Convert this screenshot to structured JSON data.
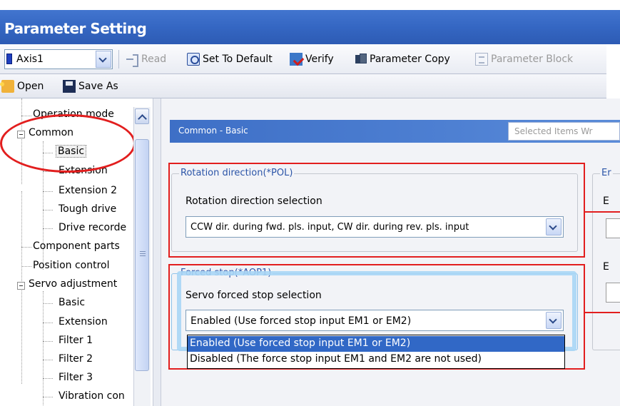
{
  "window": {
    "title": "Parameter Setting"
  },
  "toolbar1": {
    "axis": {
      "value": "Axis1"
    },
    "read": {
      "label": "Read",
      "icon": "read-arrow-icon"
    },
    "set_default": {
      "label": "Set To Default",
      "icon": "default-icon"
    },
    "verify": {
      "label": "Verify",
      "icon": "verify-icon"
    },
    "param_copy": {
      "label": "Parameter Copy",
      "icon": "copy-icon"
    },
    "param_block": {
      "label": "Parameter Block",
      "icon": "block-icon"
    }
  },
  "toolbar2": {
    "open": {
      "label": "Open",
      "icon": "open-folder-icon"
    },
    "save_as": {
      "label": "Save As",
      "icon": "save-disk-icon"
    }
  },
  "tree": {
    "items": [
      {
        "label": "Operation mode"
      },
      {
        "label": "Common"
      },
      {
        "label": "Basic"
      },
      {
        "label": "Extension"
      },
      {
        "label": "Extension 2"
      },
      {
        "label": "Tough drive"
      },
      {
        "label": "Drive recorde"
      },
      {
        "label": "Component parts"
      },
      {
        "label": "Position control"
      },
      {
        "label": "Servo adjustment"
      },
      {
        "label": "Basic"
      },
      {
        "label": "Extension"
      },
      {
        "label": "Filter 1"
      },
      {
        "label": "Filter 2"
      },
      {
        "label": "Filter 3"
      },
      {
        "label": "Vibration con"
      }
    ]
  },
  "content": {
    "header_title": "Common - Basic",
    "search_placeholder": "Selected Items Wr",
    "rotation_group": {
      "title": "Rotation direction(*POL)",
      "field_label": "Rotation direction selection",
      "selected": "CCW dir. during fwd. pls. input, CW dir. during rev. pls. input"
    },
    "forced_stop_group": {
      "title": "Forced stop(*AOP1)",
      "field_label": "Servo forced stop selection",
      "selected": "Enabled (Use forced stop input EM1 or EM2)",
      "options": [
        "Enabled (Use forced stop input EM1 or EM2)",
        "Disabled (The force stop input EM1 and EM2 are not used)"
      ]
    },
    "right_group": {
      "title": "Er",
      "label_1": "E",
      "label_2": "E"
    }
  },
  "colors": {
    "title_bar": "#3567c3",
    "highlight": "#e21e1e",
    "selection": "#3168c6"
  }
}
